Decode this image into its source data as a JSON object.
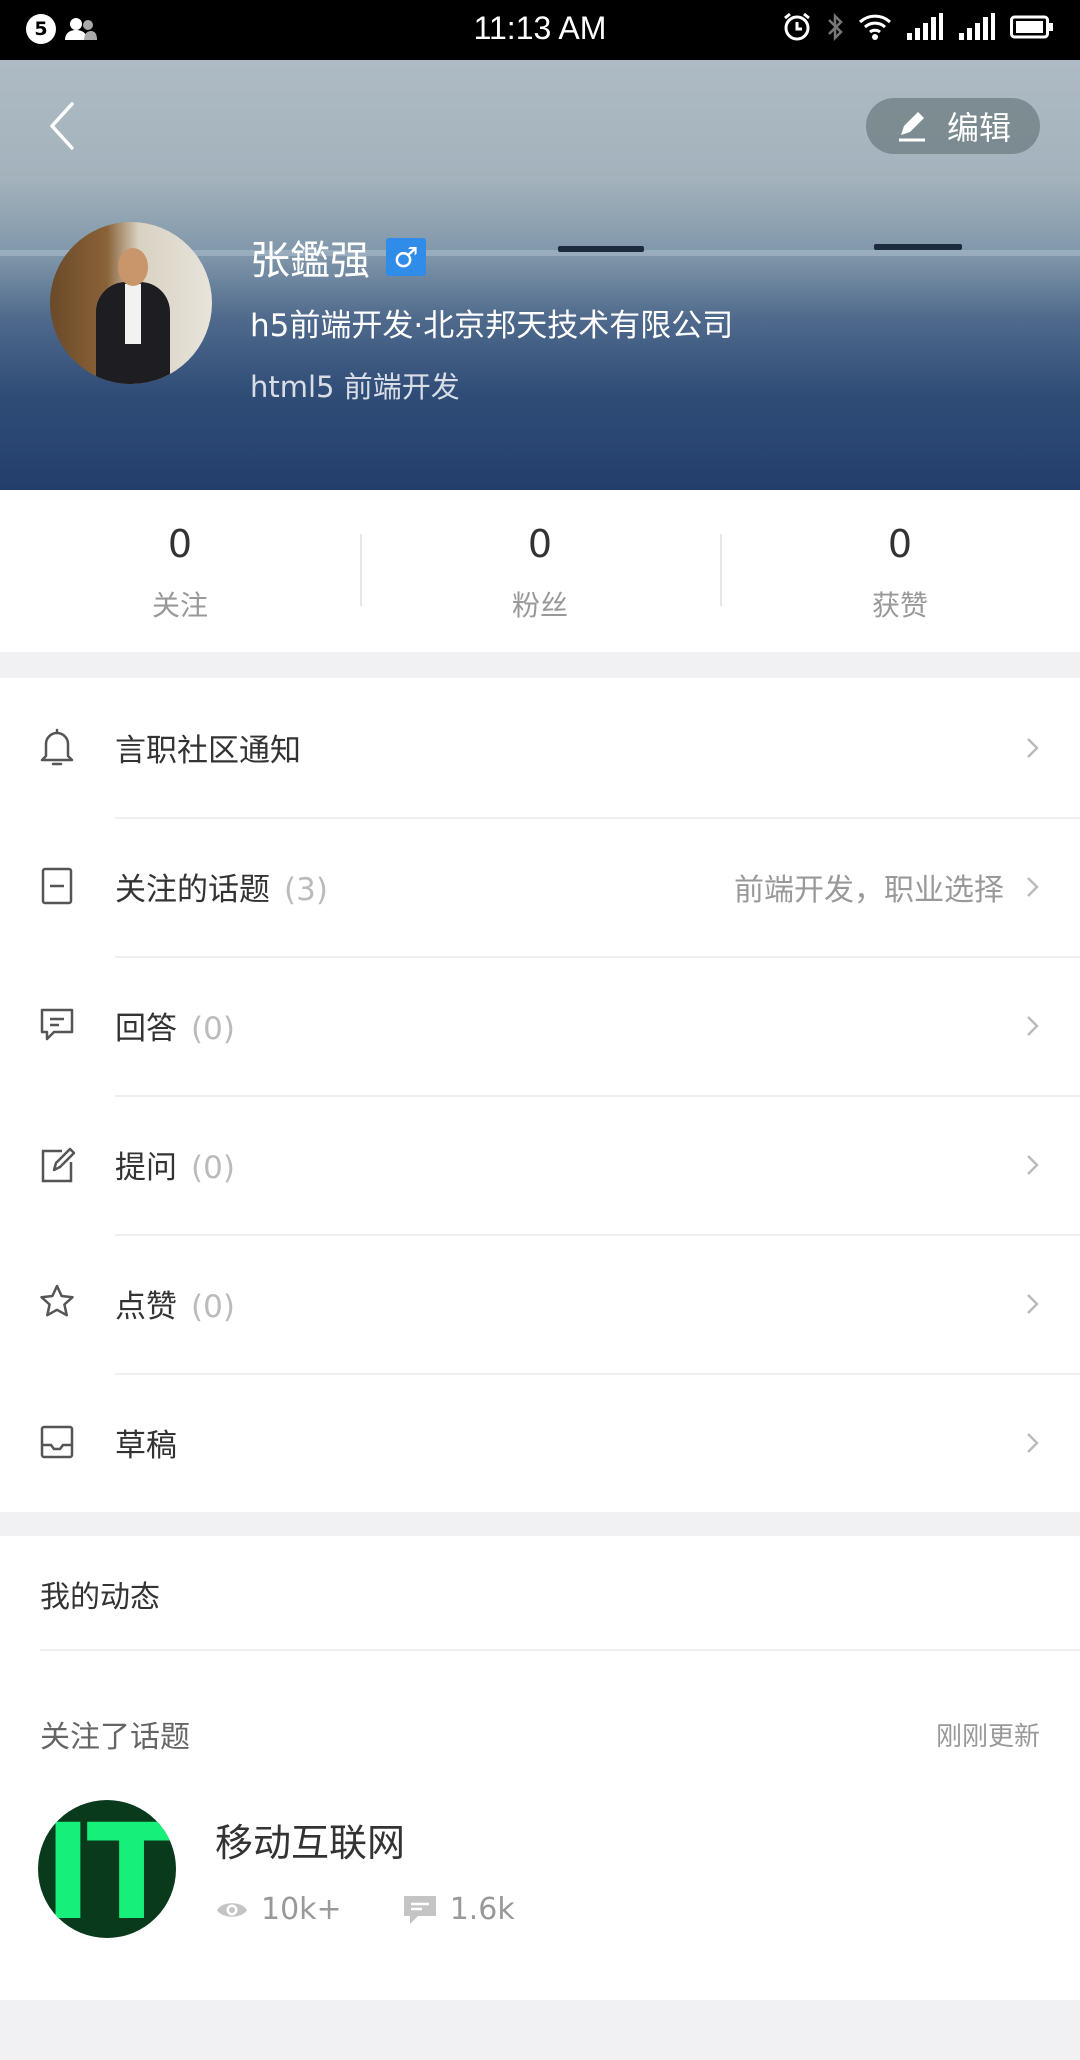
{
  "status_bar": {
    "notification_count": "5",
    "time": "11:13 AM"
  },
  "header": {
    "edit_label": "编辑",
    "name": "张鑑强",
    "gender_symbol": "♂",
    "headline": "h5前端开发·北京邦天技术有限公司",
    "tagline": "html5 前端开发"
  },
  "stats": [
    {
      "value": "0",
      "label": "关注"
    },
    {
      "value": "0",
      "label": "粉丝"
    },
    {
      "value": "0",
      "label": "获赞"
    }
  ],
  "menu": [
    {
      "icon": "bell-icon",
      "label": "言职社区通知",
      "count": "",
      "value": ""
    },
    {
      "icon": "document-icon",
      "label": "关注的话题",
      "count": "(3)",
      "value": "前端开发，职业选择"
    },
    {
      "icon": "comment-icon",
      "label": "回答",
      "count": "(0)",
      "value": ""
    },
    {
      "icon": "edit-square-icon",
      "label": "提问",
      "count": "(0)",
      "value": ""
    },
    {
      "icon": "star-icon",
      "label": "点赞",
      "count": "(0)",
      "value": ""
    },
    {
      "icon": "inbox-icon",
      "label": "草稿",
      "count": "",
      "value": ""
    }
  ],
  "activity": {
    "title": "我的动态",
    "type_label": "关注了话题",
    "time": "刚刚更新",
    "topic": {
      "logo_text": "IT",
      "name": "移动互联网",
      "views": "10k+",
      "comments": "1.6k"
    }
  },
  "colors": {
    "accent_blue": "#2f8ce8",
    "logo_green": "#16f07a"
  }
}
